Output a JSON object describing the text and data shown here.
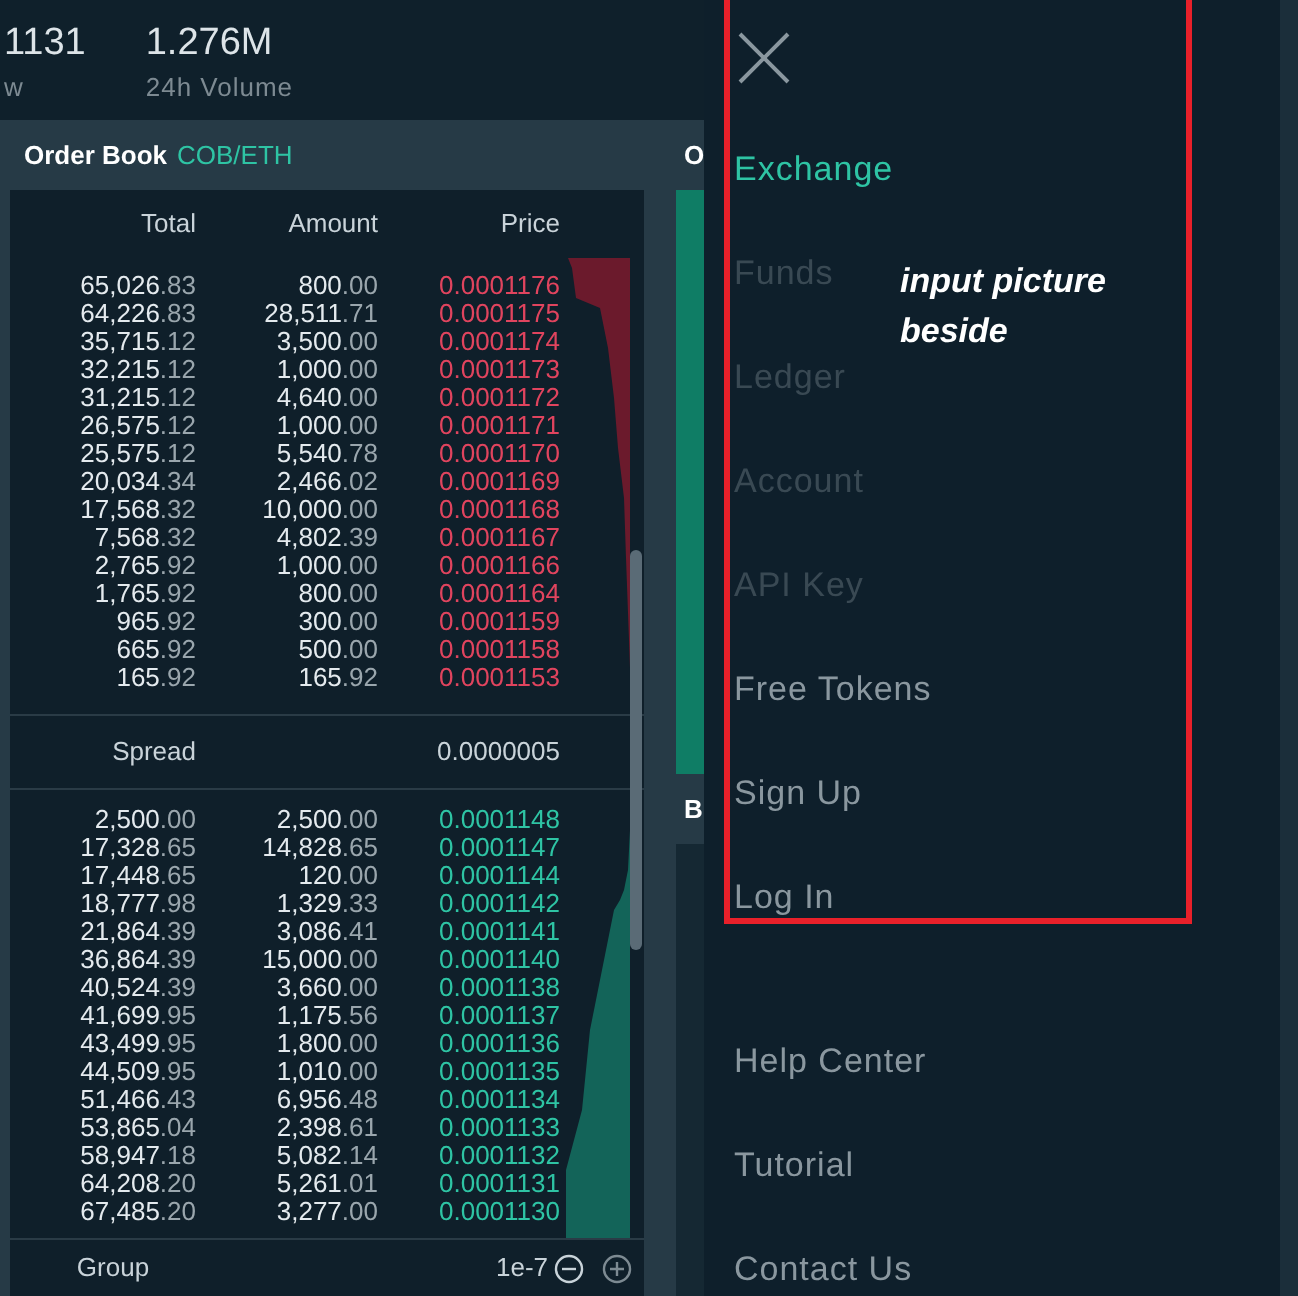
{
  "ticker": [
    {
      "value": "1131",
      "label": "w"
    },
    {
      "value": "1.276M",
      "label": "24h Volume"
    }
  ],
  "order_book": {
    "title": "Order Book",
    "pair": "COB/ETH",
    "columns": [
      "Total",
      "Amount",
      "Price"
    ],
    "asks": [
      [
        "65,026.83",
        "800.00",
        "0.0001176"
      ],
      [
        "64,226.83",
        "28,511.71",
        "0.0001175"
      ],
      [
        "35,715.12",
        "3,500.00",
        "0.0001174"
      ],
      [
        "32,215.12",
        "1,000.00",
        "0.0001173"
      ],
      [
        "31,215.12",
        "4,640.00",
        "0.0001172"
      ],
      [
        "26,575.12",
        "1,000.00",
        "0.0001171"
      ],
      [
        "25,575.12",
        "5,540.78",
        "0.0001170"
      ],
      [
        "20,034.34",
        "2,466.02",
        "0.0001169"
      ],
      [
        "17,568.32",
        "10,000.00",
        "0.0001168"
      ],
      [
        "7,568.32",
        "4,802.39",
        "0.0001167"
      ],
      [
        "2,765.92",
        "1,000.00",
        "0.0001166"
      ],
      [
        "1,765.92",
        "800.00",
        "0.0001164"
      ],
      [
        "965.92",
        "300.00",
        "0.0001159"
      ],
      [
        "665.92",
        "500.00",
        "0.0001158"
      ],
      [
        "165.92",
        "165.92",
        "0.0001153"
      ]
    ],
    "spread": {
      "label": "Spread",
      "value": "0.0000005"
    },
    "bids": [
      [
        "2,500.00",
        "2,500.00",
        "0.0001148"
      ],
      [
        "17,328.65",
        "14,828.65",
        "0.0001147"
      ],
      [
        "17,448.65",
        "120.00",
        "0.0001144"
      ],
      [
        "18,777.98",
        "1,329.33",
        "0.0001142"
      ],
      [
        "21,864.39",
        "3,086.41",
        "0.0001141"
      ],
      [
        "36,864.39",
        "15,000.00",
        "0.0001140"
      ],
      [
        "40,524.39",
        "3,660.00",
        "0.0001138"
      ],
      [
        "41,699.95",
        "1,175.56",
        "0.0001137"
      ],
      [
        "43,499.95",
        "1,800.00",
        "0.0001136"
      ],
      [
        "44,509.95",
        "1,010.00",
        "0.0001135"
      ],
      [
        "51,466.43",
        "6,956.48",
        "0.0001134"
      ],
      [
        "53,865.04",
        "2,398.61",
        "0.0001133"
      ],
      [
        "58,947.18",
        "5,082.14",
        "0.0001132"
      ],
      [
        "64,208.20",
        "5,261.01",
        "0.0001131"
      ],
      [
        "67,485.20",
        "3,277.00",
        "0.0001130"
      ]
    ],
    "group": {
      "label": "Group",
      "value": "1e-7"
    }
  },
  "side_panel": {
    "headings": [
      "O",
      "B"
    ]
  },
  "menu": {
    "items": [
      {
        "label": "Exchange",
        "selected": true,
        "disabled": false
      },
      {
        "label": "Funds",
        "selected": false,
        "disabled": true
      },
      {
        "label": "Ledger",
        "selected": false,
        "disabled": true
      },
      {
        "label": "Account",
        "selected": false,
        "disabled": true
      },
      {
        "label": "API Key",
        "selected": false,
        "disabled": true
      },
      {
        "label": "Free Tokens",
        "selected": false,
        "disabled": false
      },
      {
        "label": "Sign Up",
        "selected": false,
        "disabled": false
      },
      {
        "label": "Log In",
        "selected": false,
        "disabled": false
      }
    ],
    "footer_items": [
      "Help Center",
      "Tutorial",
      "Contact Us"
    ]
  },
  "annotation": {
    "text": "input picture beside"
  }
}
